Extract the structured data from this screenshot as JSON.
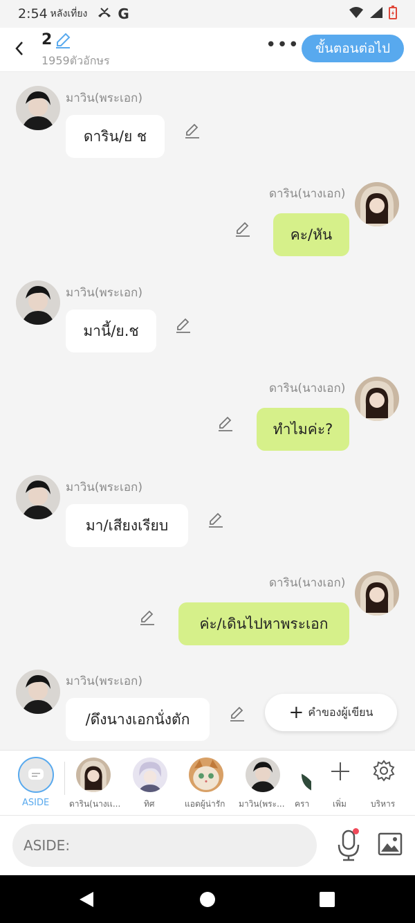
{
  "status_bar": {
    "time": "2:54",
    "time_suffix": "หลังเที่ยง",
    "g_label": "G"
  },
  "header": {
    "title": "2",
    "char_count": "1959ตัวอักษร",
    "more_label": "•••",
    "next_label": "ขั้นตอนต่อไป"
  },
  "messages": [
    {
      "side": "left",
      "name": "มาวิน(พระเอก)",
      "text": "ดาริน/ย ช"
    },
    {
      "side": "right",
      "name": "ดาริน(นางเอก)",
      "text": "คะ/หัน"
    },
    {
      "side": "left",
      "name": "มาวิน(พระเอก)",
      "text": "มานี้/ย.ช"
    },
    {
      "side": "right",
      "name": "ดาริน(นางเอก)",
      "text": "ทำไมค่ะ?"
    },
    {
      "side": "left",
      "name": "มาวิน(พระเอก)",
      "text": "มา/เสียงเรียบ"
    },
    {
      "side": "right",
      "name": "ดาริน(นางเอก)",
      "text": "ค่ะ/เดินไปหาพระเอก"
    },
    {
      "side": "left",
      "name": "มาวิน(พระเอก)",
      "text": "/ดึงนางเอกนั่งตัก"
    }
  ],
  "author_button": {
    "plus": "+",
    "label": "คำของผู้เขียน"
  },
  "characters": {
    "aside": "ASIDE",
    "items": [
      "ดาริน(นางเเ...",
      "ทิศ",
      "แอดผู้น่ารัก",
      "มาวิน(พระ...",
      "ครา"
    ],
    "add_label": "เพิ่ม",
    "manage_label": "บริหาร"
  },
  "input": {
    "placeholder": "ASIDE:"
  },
  "colors": {
    "accent": "#58a9ee",
    "right_bubble": "#d6f08a",
    "left_bubble": "#ffffff",
    "notification_dot": "#f04a5a"
  }
}
